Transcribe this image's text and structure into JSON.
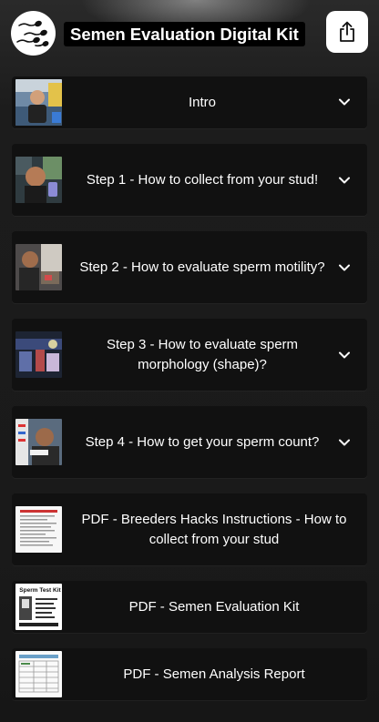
{
  "header": {
    "title": "Semen Evaluation Digital Kit"
  },
  "icons": {
    "logo": "sperm-logo-icon",
    "share": "share-icon",
    "expand": "chevron-down-icon"
  },
  "sections": [
    {
      "label": "Intro"
    },
    {
      "label": "Step 1 - How to collect from your stud!"
    },
    {
      "label": "Step 2 - How to evaluate sperm motility?"
    },
    {
      "label": "Step 3 - How to evaluate sperm morphology (shape)?"
    },
    {
      "label": "Step 4 - How to get your sperm count?"
    }
  ],
  "documents": [
    {
      "label": "PDF - Breeders Hacks Instructions - How to collect from your stud"
    },
    {
      "label": "PDF - Semen Evaluation Kit",
      "thumb_title": "Sperm Test Kit"
    },
    {
      "label": "PDF - Semen Analysis Report"
    }
  ]
}
